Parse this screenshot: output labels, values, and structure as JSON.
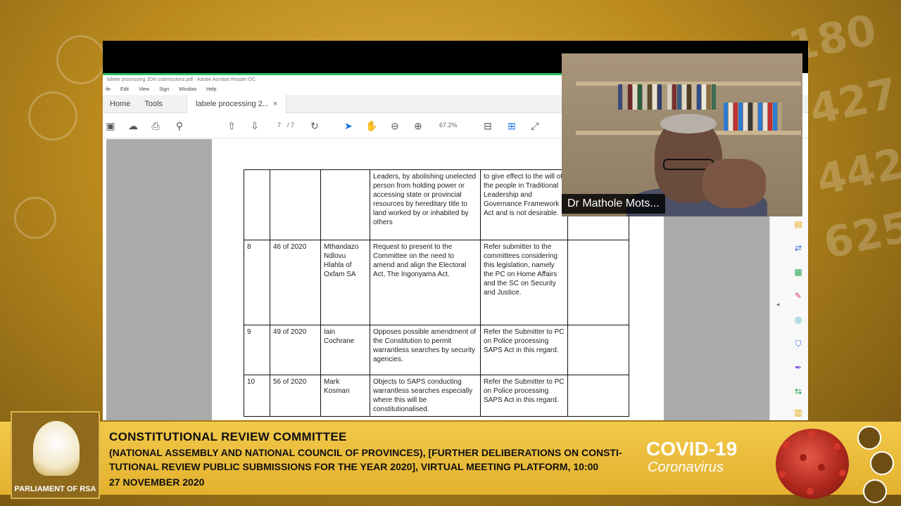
{
  "app": {
    "window_title": "labele processing JDN submissions.pdf - Adobe Acrobat Reader DC",
    "menu": [
      "ile",
      "Edit",
      "View",
      "Sign",
      "Window",
      "Help"
    ],
    "tabs": {
      "home": "Home",
      "tools": "Tools",
      "document": "labele processing 2...",
      "close": "×"
    },
    "toolbar": {
      "page_current": "7",
      "page_total": "/ 7",
      "zoom": "67.2%"
    }
  },
  "table": {
    "rows": [
      {
        "no": "",
        "ref": "",
        "name": "",
        "summary": "Leaders, by abolishing unelected person from holding power or accessing state or provincial resources by hereditary title to land worked by or inhabited by others",
        "response": "to give effect to the will of the people in Traditional Leadership and Governance Framework Act and is not desirable."
      },
      {
        "no": "8",
        "ref": "46 of 2020",
        "name": "Mthandazo Ndlovu Hlahla of Oxfam SA",
        "summary": "Request to present to the Committee on the need to amend and align the Electoral Act, The Ingonyama Act.",
        "response": "Refer submitter to the committees considering this legislation, namely the PC on Home Affairs and the SC on Security and Justice."
      },
      {
        "no": "9",
        "ref": "49 of 2020",
        "name": "Iain Cochrane",
        "summary": "Opposes possible amendment of the Constitution to permit warrantless searches by security agencies.",
        "response": "Refer the Submitter to PC on Police processing SAPS Act in this regard."
      },
      {
        "no": "10",
        "ref": "56 of 2020",
        "name": "Mark Kosman",
        "summary": "Objects to SAPS conducting warrantless searches especially where this will be constitutionalised.",
        "response": "Refer the Submitter to PC on Police processing SAPS Act in this regard."
      }
    ]
  },
  "video": {
    "participant_name": "Dr Mathole Mots..."
  },
  "broadcast": {
    "logo_text": "PARLIAMENT OF RSA",
    "title": "CONSTITUTIONAL REVIEW COMMITTEE",
    "subtitle_line1": "(NATIONAL ASSEMBLY AND NATIONAL COUNCIL OF PROVINCES), [FURTHER DELIBERATIONS ON CONSTI-",
    "subtitle_line2": "TUTIONAL REVIEW PUBLIC SUBMISSIONS FOR THE YEAR 2020], VIRTUAL MEETING PLATFORM, 10:00",
    "date": "27 NOVEMBER 2020",
    "covid_title": "COVID-19",
    "covid_sub": "Coronavirus"
  },
  "colors": {
    "gold": "#e3b12e",
    "green_bar": "#22c05a",
    "badge_bg": "#000000"
  }
}
